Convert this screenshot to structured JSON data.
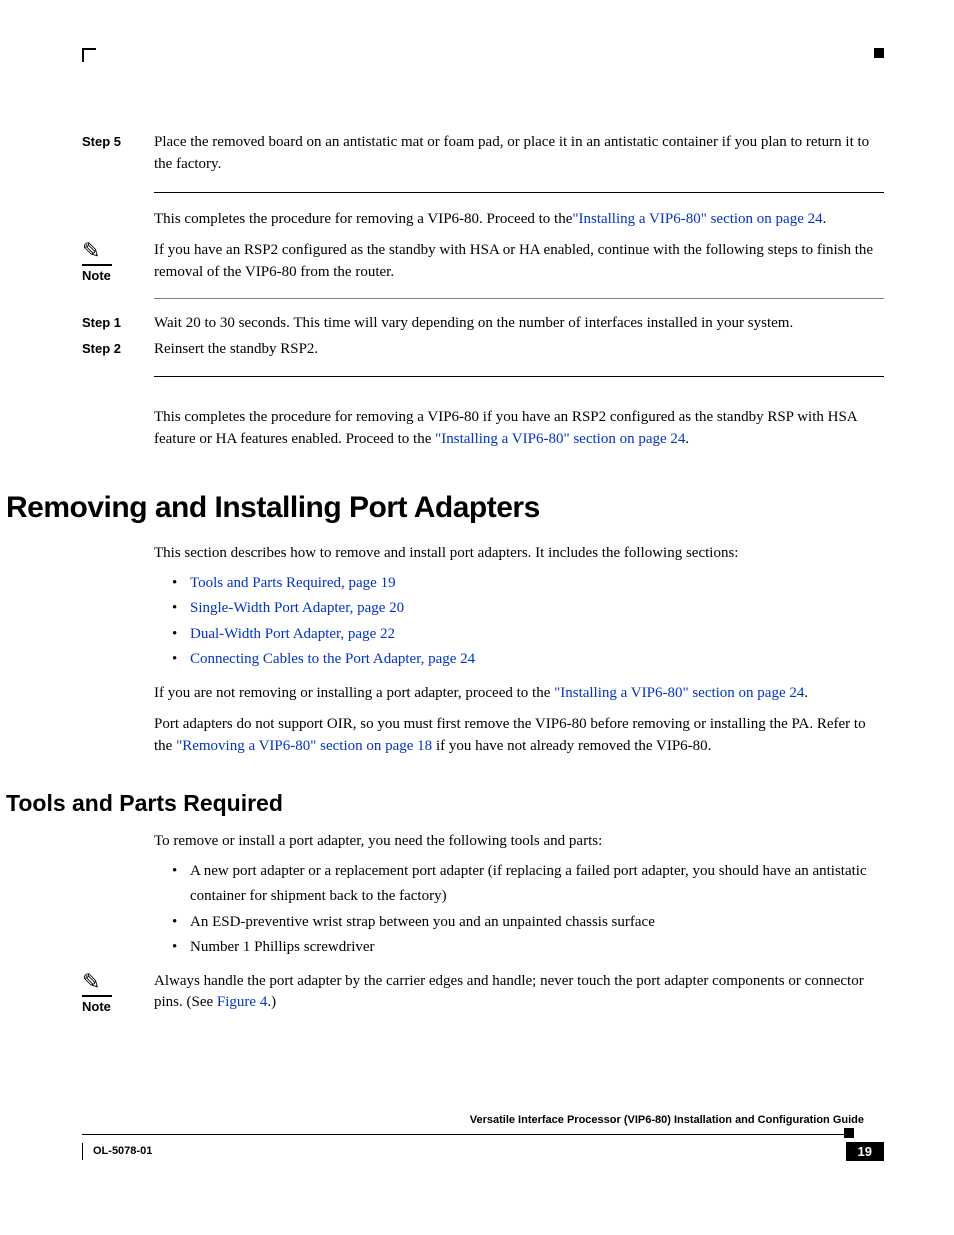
{
  "step5": {
    "label": "Step 5",
    "text": "Place the removed board on an antistatic mat or foam pad, or place it in an antistatic container if you plan to return it to the factory."
  },
  "completion1_pre": "This completes the procedure for removing a VIP6-80. Proceed to the",
  "completion1_link": "\"Installing a VIP6-80\" section on page 24",
  "completion1_post": ".",
  "note1": {
    "label": "Note",
    "text": "If you have an RSP2 configured as the standby with HSA or HA enabled, continue with the following steps to finish the removal of the VIP6-80 from the router."
  },
  "step1b": {
    "label": "Step 1",
    "text": "Wait 20 to 30 seconds. This time will vary depending on the number of interfaces installed in your system."
  },
  "step2b": {
    "label": "Step 2",
    "text": "Reinsert the standby RSP2."
  },
  "completion2_pre": "This completes the procedure for removing a VIP6-80 if you have an RSP2 configured as the standby RSP with HSA feature or HA features enabled. Proceed to the ",
  "completion2_link": "\"Installing a VIP6-80\" section on page 24",
  "completion2_post": ".",
  "h1": "Removing and Installing Port Adapters",
  "intro": "This section describes how to remove and install port adapters. It includes the following sections:",
  "toc": {
    "i0": "Tools and Parts Required, page 19",
    "i1": "Single-Width Port Adapter, page 20",
    "i2": "Dual-Width Port Adapter, page 22",
    "i3": "Connecting Cables to the Port Adapter, page 24"
  },
  "skip_pre": "If you are not removing or installing a port adapter, proceed to the ",
  "skip_link": "\"Installing a VIP6-80\" section on page 24",
  "skip_post": ".",
  "oir_pre": "Port adapters do not support OIR, so you must first remove the VIP6-80 before removing or installing the PA. Refer to the ",
  "oir_link": "\"Removing a VIP6-80\" section on page 18",
  "oir_post": " if you have not already removed the VIP6-80.",
  "h2": "Tools and Parts Required",
  "tools_intro": "To remove or install a port adapter, you need the following tools and parts:",
  "tools": {
    "i0": "A new port adapter or a replacement port adapter (if replacing a failed port adapter, you should have an antistatic container for shipment back to the factory)",
    "i1": "An ESD-preventive wrist strap between you and an unpainted chassis surface",
    "i2": "Number 1 Phillips screwdriver"
  },
  "note2": {
    "label": "Note",
    "pre": "Always handle the port adapter by the carrier edges and handle; never touch the port adapter components or connector pins. (See ",
    "link": "Figure 4",
    "post": ".)"
  },
  "footer": {
    "title": "Versatile Interface Processor (VIP6-80) Installation and Configuration Guide",
    "docnum": "OL-5078-01",
    "page": "19"
  }
}
